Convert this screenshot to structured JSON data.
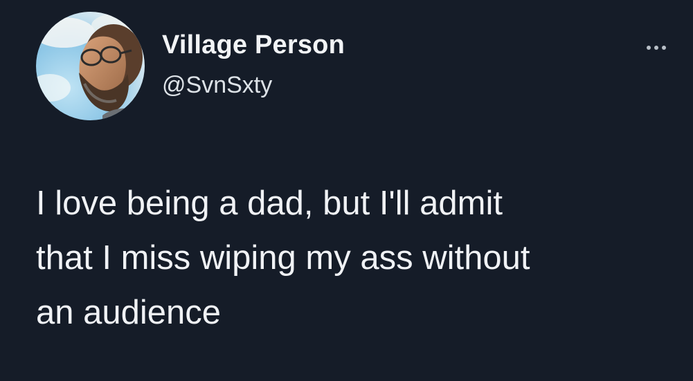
{
  "tweet": {
    "author": {
      "display_name": "Village Person",
      "handle": "@SvnSxty",
      "avatar": "bearded-man-with-glasses-avatar"
    },
    "more_icon": "ellipsis-icon",
    "text": "I love being a dad, but I'll admit\nthat I miss wiping my ass without\nan audience"
  },
  "colors": {
    "background": "#151c28",
    "text": "#f0f2f5",
    "secondary_text": "#dde2e7",
    "icon": "#b8bfc7"
  }
}
